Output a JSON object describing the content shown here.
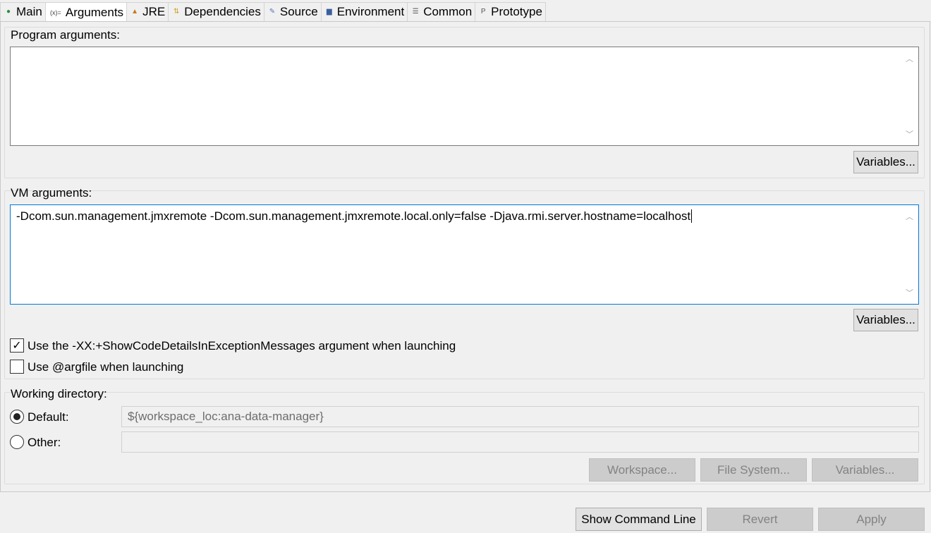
{
  "tabs": [
    {
      "label": "Main",
      "icon": "main-icon",
      "glyph": "●",
      "color": "#2e8b3e"
    },
    {
      "label": "Arguments",
      "icon": "arguments-icon",
      "glyph": "(x)=",
      "color": "#444444"
    },
    {
      "label": "JRE",
      "icon": "jre-icon",
      "glyph": "▲",
      "color": "#c87a1c"
    },
    {
      "label": "Dependencies",
      "icon": "dependencies-icon",
      "glyph": "⇅",
      "color": "#d0a020"
    },
    {
      "label": "Source",
      "icon": "source-icon",
      "glyph": "✎",
      "color": "#4a7ab0"
    },
    {
      "label": "Environment",
      "icon": "environment-icon",
      "glyph": "▆",
      "color": "#3b5f9e"
    },
    {
      "label": "Common",
      "icon": "common-icon",
      "glyph": "☰",
      "color": "#555555"
    },
    {
      "label": "Prototype",
      "icon": "prototype-icon",
      "glyph": "P",
      "color": "#555555"
    }
  ],
  "active_tab": "Arguments",
  "program_args": {
    "label": "Program arguments:",
    "value": "",
    "variables": "Variables..."
  },
  "vm_args": {
    "label": "VM arguments:",
    "value": "-Dcom.sun.management.jmxremote -Dcom.sun.management.jmxremote.local.only=false -Djava.rmi.server.hostname=localhost",
    "variables": "Variables..."
  },
  "options": {
    "show_code_details": {
      "label": "Use the -XX:+ShowCodeDetailsInExceptionMessages argument when launching",
      "checked": true
    },
    "argfile": {
      "label": "Use @argfile when launching",
      "checked": false
    }
  },
  "working_dir": {
    "label": "Working directory:",
    "default_label": "Default:",
    "default_value": "${workspace_loc:ana-data-manager}",
    "default_selected": true,
    "other_label": "Other:",
    "other_value": "",
    "workspace": "Workspace...",
    "file_system": "File System...",
    "variables": "Variables..."
  },
  "footer": {
    "show_command_line": "Show Command Line",
    "revert": "Revert",
    "apply": "Apply"
  },
  "colors": {
    "focus_border": "#0078d7"
  }
}
